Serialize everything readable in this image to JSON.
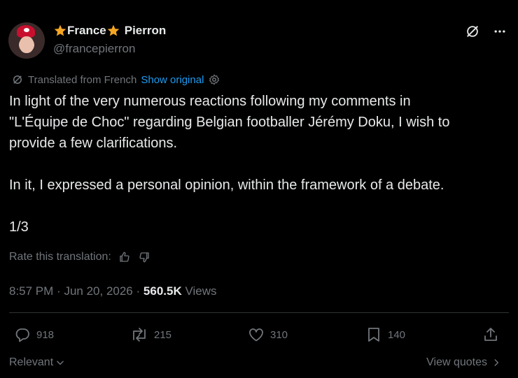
{
  "author": {
    "display_name_part1": "France",
    "display_name_part2": "Pierron",
    "handle": "@francepierron"
  },
  "translation": {
    "translated_from": "Translated from French",
    "show_original": "Show original"
  },
  "tweet": {
    "text": "In light of the very numerous reactions following my comments in\n\"L'Équipe de Choc\" regarding Belgian footballer Jérémy Doku, I wish to\nprovide a few clarifications.\n\nIn it, I expressed a personal opinion, within the framework of a debate.\n\n1/3"
  },
  "rate": {
    "label": "Rate this translation:"
  },
  "meta": {
    "time": "8:57 PM",
    "separator": "·",
    "date": "Jun 20, 2026",
    "views_count": "560.5K",
    "views_label": "Views"
  },
  "actions": {
    "replies": "918",
    "reposts": "215",
    "likes": "310",
    "bookmarks": "140"
  },
  "footer": {
    "relevant": "Relevant",
    "view_quotes": "View quotes"
  },
  "colors": {
    "background": "#000000",
    "text": "#e7e9ea",
    "muted": "#71767b",
    "accent": "#1d9bf0",
    "star": "#f5a623"
  },
  "icons": [
    "grok-icon",
    "more-icon",
    "translate-icon",
    "settings-icon",
    "thumbs-up-icon",
    "thumbs-down-icon",
    "reply-icon",
    "repost-icon",
    "like-icon",
    "bookmark-icon",
    "share-icon",
    "chevron-down-icon",
    "chevron-right-icon",
    "star-icon"
  ]
}
